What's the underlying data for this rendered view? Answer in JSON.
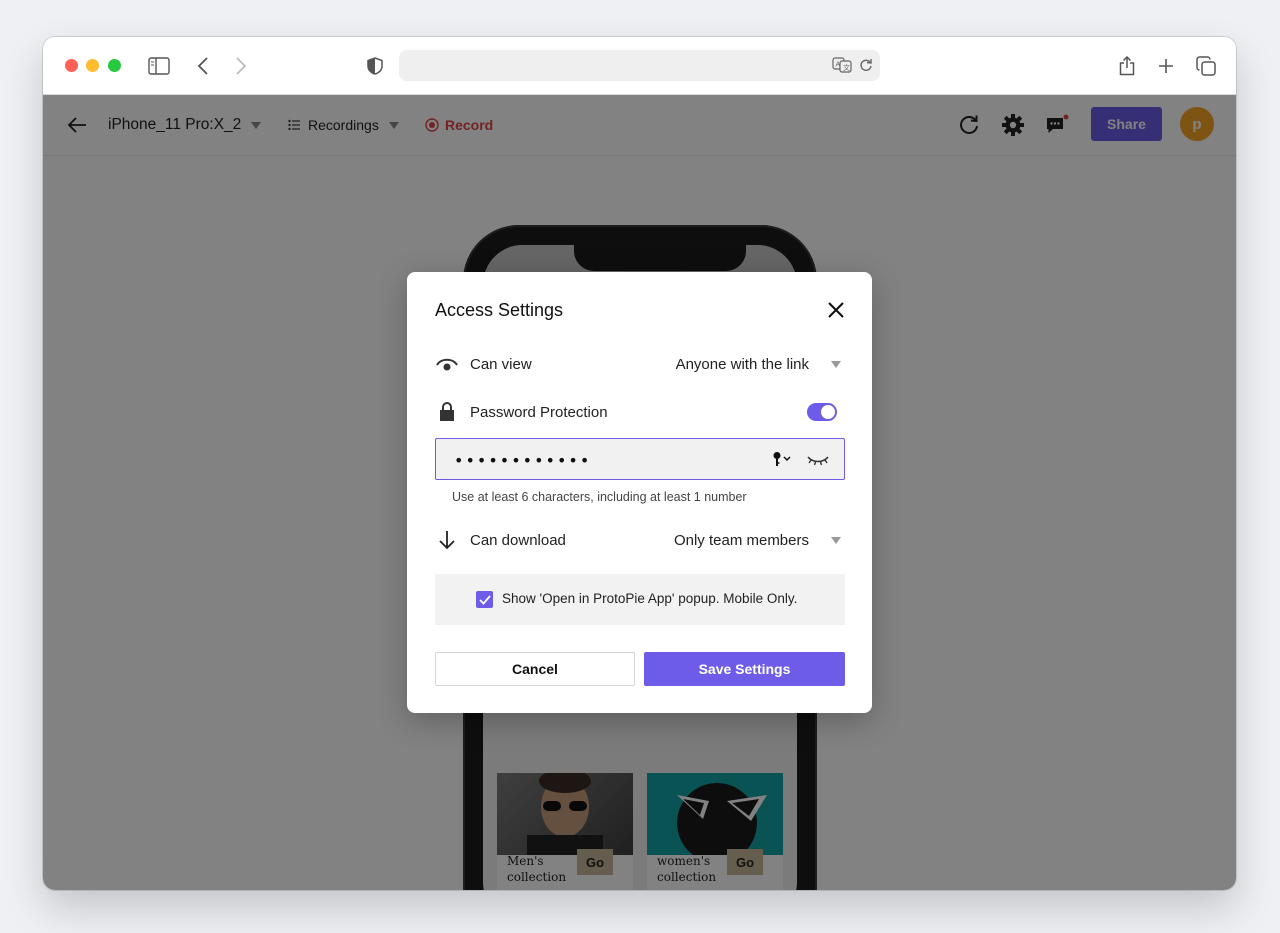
{
  "browser": {
    "icons": [
      "sidebar-icon",
      "back-icon",
      "forward-icon",
      "shield-icon",
      "translate-icon",
      "reload-icon",
      "share-icon",
      "new-tab-icon",
      "tabs-overview-icon"
    ]
  },
  "toolbar": {
    "device": "iPhone_11 Pro:X_2",
    "recordings": "Recordings",
    "record": "Record",
    "share": "Share",
    "avatar_initial": "p",
    "accent_color": "#6c5ce7",
    "record_color": "#e0464b"
  },
  "phone": {
    "card1": {
      "label_line1": "Men's",
      "label_line2": "collection",
      "go": "Go"
    },
    "card2": {
      "label_line1": "women's",
      "label_line2": "collection",
      "go": "Go"
    }
  },
  "modal": {
    "title": "Access Settings",
    "can_view": {
      "label": "Can view",
      "value": "Anyone with the link"
    },
    "password": {
      "label": "Password Protection",
      "enabled": true,
      "value": "••••••••••••",
      "hint": "Use at least 6 characters, including at least 1 number"
    },
    "can_download": {
      "label": "Can download",
      "value": "Only team members"
    },
    "popup_option": {
      "label": "Show 'Open in ProtoPie App' popup. Mobile Only.",
      "checked": true
    },
    "cancel": "Cancel",
    "save": "Save Settings"
  }
}
